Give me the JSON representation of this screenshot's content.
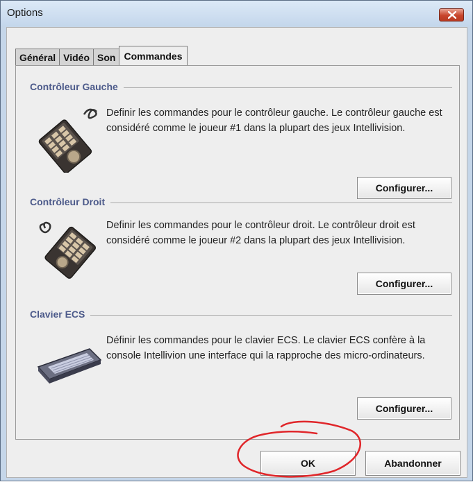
{
  "window": {
    "title": "Options"
  },
  "tabs": [
    {
      "label": "Général",
      "active": false
    },
    {
      "label": "Vidéo",
      "active": false
    },
    {
      "label": "Son",
      "active": false
    },
    {
      "label": "Commandes",
      "active": true
    }
  ],
  "sections": [
    {
      "title": "Contrôleur Gauche",
      "description": "Definir les commandes pour le contrôleur gauche.  Le contrôleur gauche est considéré comme le joueur #1 dans la plupart des jeux Intellivision.",
      "button_label": "Configurer...",
      "icon": "left-controller-icon"
    },
    {
      "title": "Contrôleur Droit",
      "description": "Definir les commandes pour le contrôleur droit.  Le contrôleur droit est considéré comme le joueur #2 dans la plupart des jeux Intellivision.",
      "button_label": "Configurer...",
      "icon": "right-controller-icon"
    },
    {
      "title": "Clavier ECS",
      "description": "Définir les commandes pour le clavier ECS.  Le clavier ECS confère à la console Intellivion une interface qui la rapproche des micro-ordinateurs.",
      "button_label": "Configurer...",
      "icon": "ecs-keyboard-icon"
    }
  ],
  "footer": {
    "ok_label": "OK",
    "cancel_label": "Abandonner"
  },
  "colors": {
    "section_title": "#4c5a8a",
    "annotation": "#e0262a",
    "close_button": "#c8452c"
  }
}
